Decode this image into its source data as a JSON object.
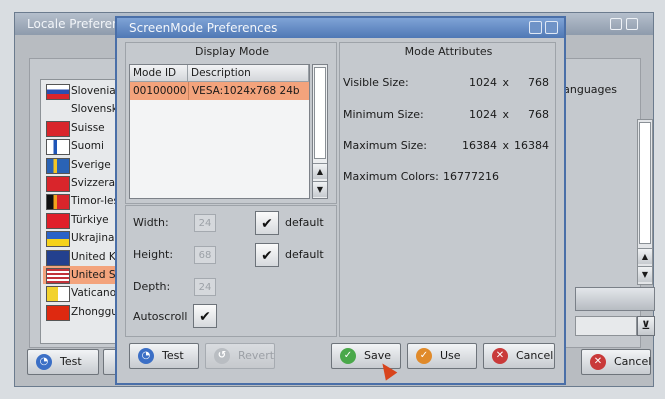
{
  "locale_window": {
    "title": "Locale Preferences",
    "list_items": [
      {
        "label": "Slovenia",
        "flag": "slovenia-flag"
      },
      {
        "label": "Slovensko",
        "flag": "none"
      },
      {
        "label": "Suisse",
        "flag": "swiss-flag"
      },
      {
        "label": "Suomi",
        "flag": "finland-flag"
      },
      {
        "label": "Sverige",
        "flag": "sweden-flag"
      },
      {
        "label": "Svizzera",
        "flag": "swiss-flag"
      },
      {
        "label": "Timor-leste",
        "flag": "timor-flag"
      },
      {
        "label": "Türkiye",
        "flag": "turkey-flag"
      },
      {
        "label": "Ukrajina",
        "flag": "ukraine-flag"
      },
      {
        "label": "United Kingdom",
        "flag": "uk-flag"
      },
      {
        "label": "United States",
        "flag": "us-flag",
        "selected": true
      },
      {
        "label": "Vaticano",
        "flag": "vatican-flag"
      },
      {
        "label": "Zhongguo",
        "flag": "china-flag"
      }
    ],
    "languages_label": "Languages",
    "test_label": "Test",
    "cancel_label": "Cancel"
  },
  "dialog": {
    "title": "ScreenMode Preferences",
    "display_mode_header": "Display Mode",
    "mode_attributes_header": "Mode Attributes",
    "columns": [
      "Mode ID",
      "Description"
    ],
    "rows": [
      {
        "id": "00100000",
        "description": "VESA:1024x768 24b"
      }
    ],
    "width_label": "Width:",
    "width_value": "24",
    "height_label": "Height:",
    "height_value": "68",
    "depth_label": "Depth:",
    "depth_value": "24",
    "autoscroll_label": "Autoscroll",
    "default_label": "default",
    "attributes": [
      {
        "label": "Visible Size:",
        "w": "1024",
        "x": "x",
        "h": "768"
      },
      {
        "label": "Minimum Size:",
        "w": "1024",
        "x": "x",
        "h": "768"
      },
      {
        "label": "Maximum Size:",
        "w": "16384",
        "x": "x",
        "h": "16384"
      }
    ],
    "max_colors_label": "Maximum Colors:",
    "max_colors_value": "16777216",
    "buttons": {
      "test": "Test",
      "revert": "Revert",
      "save": "Save",
      "use": "Use",
      "cancel": "Cancel"
    }
  },
  "colors": {
    "title_bar": "#4f78b5",
    "selection": "#f3a37c",
    "panel": "#c5c9ce"
  }
}
